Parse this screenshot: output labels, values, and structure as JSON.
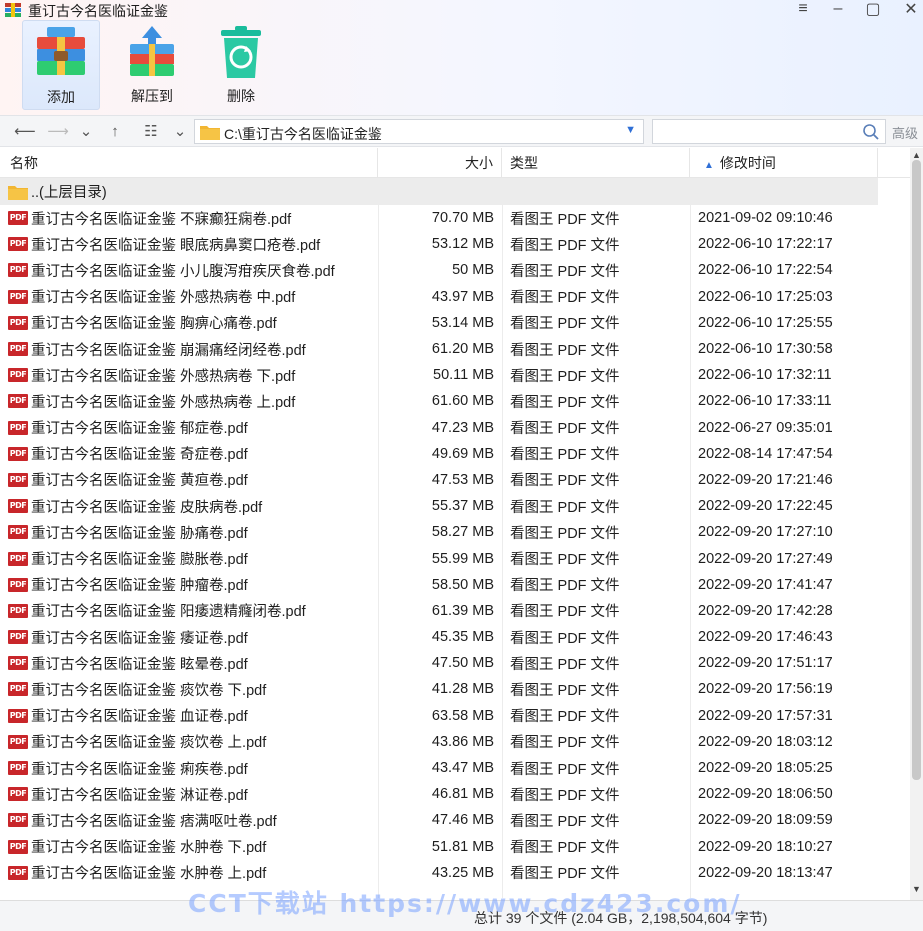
{
  "window": {
    "title": "重订古今名医临证金鉴",
    "controls": {
      "menu": "≡",
      "minimize": "–",
      "maximize": "▢",
      "close": "✕"
    }
  },
  "toolbar": {
    "add_label": "添加",
    "extract_label": "解压到",
    "delete_label": "删除"
  },
  "nav": {
    "path": "C:\\重订古今名医临证金鉴",
    "search_placeholder": "",
    "advanced_label": "高级"
  },
  "columns": {
    "name": "名称",
    "size": "大小",
    "type": "类型",
    "modified": "修改时间"
  },
  "parent_dir": "..(上层目录)",
  "files": [
    {
      "name": "重订古今名医临证金鉴 不寐癫狂痫卷.pdf",
      "size": "70.70 MB",
      "type": "看图王 PDF 文件",
      "modified": "2021-09-02 09:10:46"
    },
    {
      "name": "重订古今名医临证金鉴 眼底病鼻窦口疮卷.pdf",
      "size": "53.12 MB",
      "type": "看图王 PDF 文件",
      "modified": "2022-06-10 17:22:17"
    },
    {
      "name": "重订古今名医临证金鉴 小儿腹泻疳疾厌食卷.pdf",
      "size": "50 MB",
      "type": "看图王 PDF 文件",
      "modified": "2022-06-10 17:22:54"
    },
    {
      "name": "重订古今名医临证金鉴 外感热病卷 中.pdf",
      "size": "43.97 MB",
      "type": "看图王 PDF 文件",
      "modified": "2022-06-10 17:25:03"
    },
    {
      "name": "重订古今名医临证金鉴 胸痹心痛卷.pdf",
      "size": "53.14 MB",
      "type": "看图王 PDF 文件",
      "modified": "2022-06-10 17:25:55"
    },
    {
      "name": "重订古今名医临证金鉴 崩漏痛经闭经卷.pdf",
      "size": "61.20 MB",
      "type": "看图王 PDF 文件",
      "modified": "2022-06-10 17:30:58"
    },
    {
      "name": "重订古今名医临证金鉴 外感热病卷 下.pdf",
      "size": "50.11 MB",
      "type": "看图王 PDF 文件",
      "modified": "2022-06-10 17:32:11"
    },
    {
      "name": "重订古今名医临证金鉴 外感热病卷 上.pdf",
      "size": "61.60 MB",
      "type": "看图王 PDF 文件",
      "modified": "2022-06-10 17:33:11"
    },
    {
      "name": "重订古今名医临证金鉴 郁症卷.pdf",
      "size": "47.23 MB",
      "type": "看图王 PDF 文件",
      "modified": "2022-06-27 09:35:01"
    },
    {
      "name": "重订古今名医临证金鉴 奇症卷.pdf",
      "size": "49.69 MB",
      "type": "看图王 PDF 文件",
      "modified": "2022-08-14 17:47:54"
    },
    {
      "name": "重订古今名医临证金鉴 黄疸卷.pdf",
      "size": "47.53 MB",
      "type": "看图王 PDF 文件",
      "modified": "2022-09-20 17:21:46"
    },
    {
      "name": "重订古今名医临证金鉴 皮肤病卷.pdf",
      "size": "55.37 MB",
      "type": "看图王 PDF 文件",
      "modified": "2022-09-20 17:22:45"
    },
    {
      "name": "重订古今名医临证金鉴 胁痛卷.pdf",
      "size": "58.27 MB",
      "type": "看图王 PDF 文件",
      "modified": "2022-09-20 17:27:10"
    },
    {
      "name": "重订古今名医临证金鉴 臌胀卷.pdf",
      "size": "55.99 MB",
      "type": "看图王 PDF 文件",
      "modified": "2022-09-20 17:27:49"
    },
    {
      "name": "重订古今名医临证金鉴 肿瘤卷.pdf",
      "size": "58.50 MB",
      "type": "看图王 PDF 文件",
      "modified": "2022-09-20 17:41:47"
    },
    {
      "name": "重订古今名医临证金鉴 阳痿遗精癃闭卷.pdf",
      "size": "61.39 MB",
      "type": "看图王 PDF 文件",
      "modified": "2022-09-20 17:42:28"
    },
    {
      "name": "重订古今名医临证金鉴 痿证卷.pdf",
      "size": "45.35 MB",
      "type": "看图王 PDF 文件",
      "modified": "2022-09-20 17:46:43"
    },
    {
      "name": "重订古今名医临证金鉴 眩晕卷.pdf",
      "size": "47.50 MB",
      "type": "看图王 PDF 文件",
      "modified": "2022-09-20 17:51:17"
    },
    {
      "name": "重订古今名医临证金鉴 痰饮卷 下.pdf",
      "size": "41.28 MB",
      "type": "看图王 PDF 文件",
      "modified": "2022-09-20 17:56:19"
    },
    {
      "name": "重订古今名医临证金鉴 血证卷.pdf",
      "size": "63.58 MB",
      "type": "看图王 PDF 文件",
      "modified": "2022-09-20 17:57:31"
    },
    {
      "name": "重订古今名医临证金鉴 痰饮卷 上.pdf",
      "size": "43.86 MB",
      "type": "看图王 PDF 文件",
      "modified": "2022-09-20 18:03:12"
    },
    {
      "name": "重订古今名医临证金鉴 痢疾卷.pdf",
      "size": "43.47 MB",
      "type": "看图王 PDF 文件",
      "modified": "2022-09-20 18:05:25"
    },
    {
      "name": "重订古今名医临证金鉴 淋证卷.pdf",
      "size": "46.81 MB",
      "type": "看图王 PDF 文件",
      "modified": "2022-09-20 18:06:50"
    },
    {
      "name": "重订古今名医临证金鉴 痞满呕吐卷.pdf",
      "size": "47.46 MB",
      "type": "看图王 PDF 文件",
      "modified": "2022-09-20 18:09:59"
    },
    {
      "name": "重订古今名医临证金鉴 水肿卷 下.pdf",
      "size": "51.81 MB",
      "type": "看图王 PDF 文件",
      "modified": "2022-09-20 18:10:27"
    },
    {
      "name": "重订古今名医临证金鉴 水肿卷 上.pdf",
      "size": "43.25 MB",
      "type": "看图王 PDF 文件",
      "modified": "2022-09-20 18:13:47"
    }
  ],
  "status": "总计 39 个文件 (2.04 GB，2,198,504,604 字节)",
  "watermark": "CCT下载站 https://www.cdz423.com/",
  "colors": {
    "accent": "#2f6fd6",
    "pdf_badge": "#c8262a",
    "folder": "#f2b632"
  }
}
